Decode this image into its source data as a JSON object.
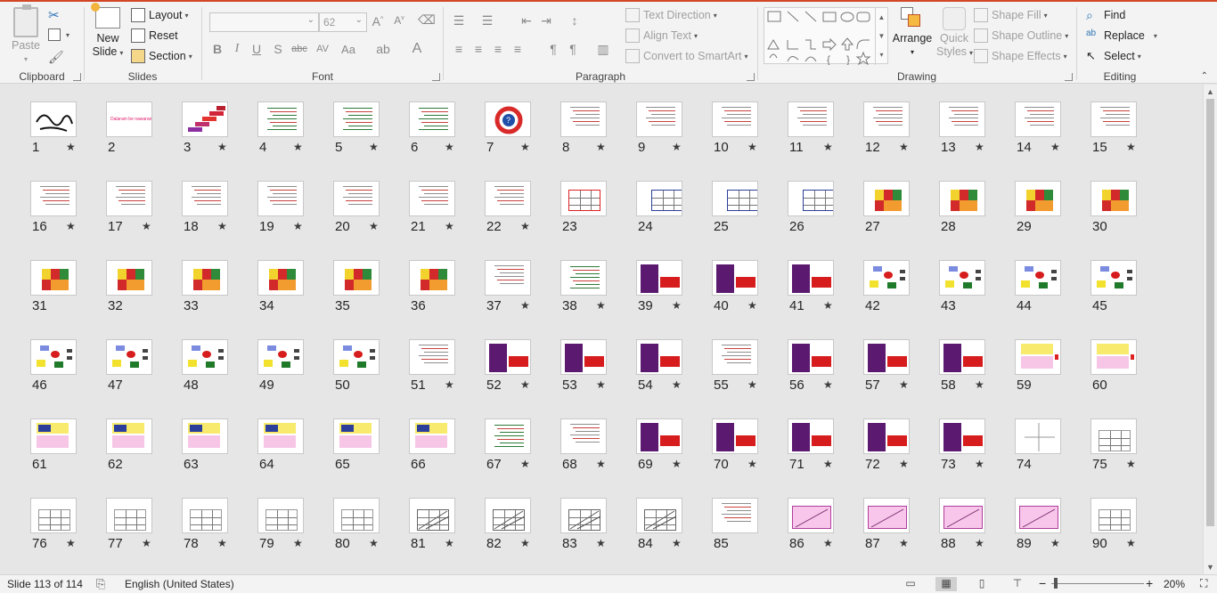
{
  "ribbon": {
    "clipboard": {
      "paste": "Paste",
      "label": "Clipboard"
    },
    "slides": {
      "new_slide": "New",
      "new_slide2": "Slide",
      "layout": "Layout",
      "reset": "Reset",
      "section": "Section",
      "label": "Slides"
    },
    "font": {
      "font_name": "",
      "font_size": "62",
      "bold": "B",
      "italic": "I",
      "underline": "U",
      "shadow": "S",
      "strike": "abc",
      "spacing": "AV",
      "case": "Aa",
      "label": "Font"
    },
    "paragraph": {
      "text_direction": "Text Direction",
      "align_text": "Align Text",
      "smartart": "Convert to SmartArt",
      "label": "Paragraph"
    },
    "drawing": {
      "arrange": "Arrange",
      "quick_styles": "Quick",
      "quick_styles2": "Styles",
      "shape_fill": "Shape Fill",
      "shape_outline": "Shape Outline",
      "shape_effects": "Shape Effects",
      "label": "Drawing"
    },
    "editing": {
      "find": "Find",
      "replace": "Replace",
      "select": "Select",
      "label": "Editing"
    }
  },
  "slides": [
    {
      "n": "1",
      "star": true,
      "kind": "calli"
    },
    {
      "n": "2",
      "star": false,
      "kind": "pinktext"
    },
    {
      "n": "3",
      "star": true,
      "kind": "stairs"
    },
    {
      "n": "4",
      "star": true,
      "kind": "greentext"
    },
    {
      "n": "5",
      "star": true,
      "kind": "greentext"
    },
    {
      "n": "6",
      "star": true,
      "kind": "greentext"
    },
    {
      "n": "7",
      "star": true,
      "kind": "cycle"
    },
    {
      "n": "8",
      "star": true,
      "kind": "text"
    },
    {
      "n": "9",
      "star": true,
      "kind": "text"
    },
    {
      "n": "10",
      "star": true,
      "kind": "text"
    },
    {
      "n": "11",
      "star": true,
      "kind": "text"
    },
    {
      "n": "12",
      "star": true,
      "kind": "text"
    },
    {
      "n": "13",
      "star": true,
      "kind": "text"
    },
    {
      "n": "14",
      "star": true,
      "kind": "text"
    },
    {
      "n": "15",
      "star": true,
      "kind": "text"
    },
    {
      "n": "16",
      "star": true,
      "kind": "text"
    },
    {
      "n": "17",
      "star": true,
      "kind": "text"
    },
    {
      "n": "18",
      "star": true,
      "kind": "text"
    },
    {
      "n": "19",
      "star": true,
      "kind": "text"
    },
    {
      "n": "20",
      "star": true,
      "kind": "text"
    },
    {
      "n": "21",
      "star": true,
      "kind": "text"
    },
    {
      "n": "22",
      "star": true,
      "kind": "text"
    },
    {
      "n": "23",
      "star": false,
      "kind": "redgrid"
    },
    {
      "n": "24",
      "star": false,
      "kind": "bluegrid"
    },
    {
      "n": "25",
      "star": false,
      "kind": "bluegrid"
    },
    {
      "n": "26",
      "star": false,
      "kind": "bluegrid"
    },
    {
      "n": "27",
      "star": false,
      "kind": "colorgrid"
    },
    {
      "n": "28",
      "star": false,
      "kind": "colorgrid"
    },
    {
      "n": "29",
      "star": false,
      "kind": "colorgrid"
    },
    {
      "n": "30",
      "star": false,
      "kind": "colorgrid"
    },
    {
      "n": "31",
      "star": false,
      "kind": "colorgrid"
    },
    {
      "n": "32",
      "star": false,
      "kind": "colorgrid"
    },
    {
      "n": "33",
      "star": false,
      "kind": "colorgrid"
    },
    {
      "n": "34",
      "star": false,
      "kind": "colorgrid"
    },
    {
      "n": "35",
      "star": false,
      "kind": "colorgrid"
    },
    {
      "n": "36",
      "star": false,
      "kind": "colorgrid"
    },
    {
      "n": "37",
      "star": true,
      "kind": "text"
    },
    {
      "n": "38",
      "star": true,
      "kind": "greentext"
    },
    {
      "n": "39",
      "star": true,
      "kind": "purple"
    },
    {
      "n": "40",
      "star": true,
      "kind": "purple"
    },
    {
      "n": "41",
      "star": true,
      "kind": "purple"
    },
    {
      "n": "42",
      "star": false,
      "kind": "flow"
    },
    {
      "n": "43",
      "star": false,
      "kind": "flow"
    },
    {
      "n": "44",
      "star": false,
      "kind": "flow"
    },
    {
      "n": "45",
      "star": false,
      "kind": "flow"
    },
    {
      "n": "46",
      "star": false,
      "kind": "flow"
    },
    {
      "n": "47",
      "star": false,
      "kind": "flow"
    },
    {
      "n": "48",
      "star": false,
      "kind": "flow"
    },
    {
      "n": "49",
      "star": false,
      "kind": "flow"
    },
    {
      "n": "50",
      "star": false,
      "kind": "flow"
    },
    {
      "n": "51",
      "star": true,
      "kind": "text"
    },
    {
      "n": "52",
      "star": true,
      "kind": "purple"
    },
    {
      "n": "53",
      "star": true,
      "kind": "purple"
    },
    {
      "n": "54",
      "star": true,
      "kind": "purple"
    },
    {
      "n": "55",
      "star": true,
      "kind": "text"
    },
    {
      "n": "56",
      "star": true,
      "kind": "purple"
    },
    {
      "n": "57",
      "star": true,
      "kind": "purple"
    },
    {
      "n": "58",
      "star": true,
      "kind": "purple"
    },
    {
      "n": "59",
      "star": false,
      "kind": "yellowpink"
    },
    {
      "n": "60",
      "star": false,
      "kind": "yellowpink"
    },
    {
      "n": "61",
      "star": false,
      "kind": "ypgrid"
    },
    {
      "n": "62",
      "star": false,
      "kind": "ypgrid"
    },
    {
      "n": "63",
      "star": false,
      "kind": "ypgrid"
    },
    {
      "n": "64",
      "star": false,
      "kind": "ypgrid"
    },
    {
      "n": "65",
      "star": false,
      "kind": "ypgrid"
    },
    {
      "n": "66",
      "star": false,
      "kind": "ypgrid"
    },
    {
      "n": "67",
      "star": true,
      "kind": "greentext"
    },
    {
      "n": "68",
      "star": true,
      "kind": "text"
    },
    {
      "n": "69",
      "star": true,
      "kind": "purple"
    },
    {
      "n": "70",
      "star": true,
      "kind": "purple"
    },
    {
      "n": "71",
      "star": true,
      "kind": "purple"
    },
    {
      "n": "72",
      "star": true,
      "kind": "purple"
    },
    {
      "n": "73",
      "star": true,
      "kind": "purple"
    },
    {
      "n": "74",
      "star": false,
      "kind": "cross"
    },
    {
      "n": "75",
      "star": true,
      "kind": "table"
    },
    {
      "n": "76",
      "star": true,
      "kind": "table"
    },
    {
      "n": "77",
      "star": true,
      "kind": "table"
    },
    {
      "n": "78",
      "star": true,
      "kind": "table"
    },
    {
      "n": "79",
      "star": true,
      "kind": "table"
    },
    {
      "n": "80",
      "star": true,
      "kind": "table"
    },
    {
      "n": "81",
      "star": true,
      "kind": "diag"
    },
    {
      "n": "82",
      "star": true,
      "kind": "diag"
    },
    {
      "n": "83",
      "star": true,
      "kind": "diag"
    },
    {
      "n": "84",
      "star": true,
      "kind": "diag"
    },
    {
      "n": "85",
      "star": false,
      "kind": "text"
    },
    {
      "n": "86",
      "star": true,
      "kind": "pinkdiag"
    },
    {
      "n": "87",
      "star": true,
      "kind": "pinkdiag"
    },
    {
      "n": "88",
      "star": true,
      "kind": "pinkdiag"
    },
    {
      "n": "89",
      "star": true,
      "kind": "pinkdiag"
    },
    {
      "n": "90",
      "star": true,
      "kind": "table"
    }
  ],
  "slide2_text": "Dalaram be nawaran",
  "status": {
    "slide_info": "Slide 113 of 114",
    "language": "English (United States)",
    "zoom": "20%",
    "zoom_fraction": 0.2
  }
}
